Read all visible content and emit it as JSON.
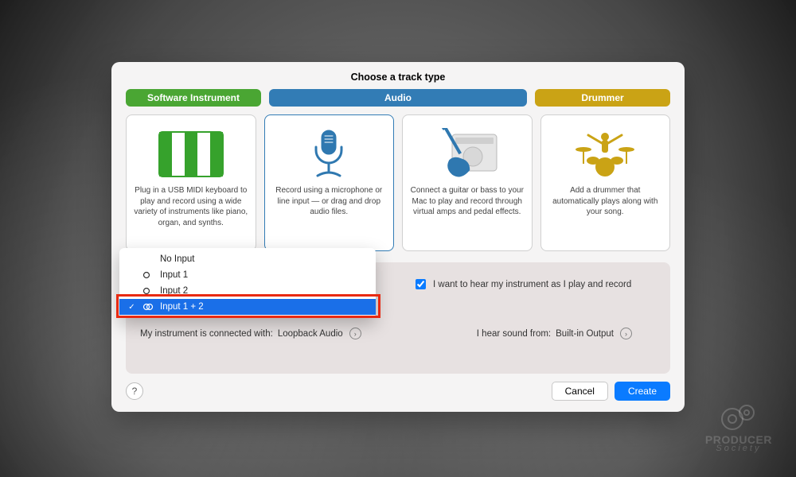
{
  "title": "Choose a track type",
  "tabs": {
    "software": "Software Instrument",
    "audio": "Audio",
    "drummer": "Drummer"
  },
  "cards": {
    "software": "Plug in a USB MIDI keyboard to play and record using a wide variety of instruments like piano, organ, and synths.",
    "mic": "Record using a microphone or line input — or drag and drop audio files.",
    "guitar": "Connect a guitar or bass to your Mac to play and record through virtual amps and pedal effects.",
    "drummer": "Add a drummer that automatically plays along with your song."
  },
  "dropdown": {
    "no_input": "No Input",
    "input1": "Input 1",
    "input2": "Input 2",
    "input12": "Input 1 + 2"
  },
  "details": {
    "hear_label": "I want to hear my instrument as I play and record",
    "connected_label": "My instrument is connected with:",
    "connected_value": "Loopback Audio",
    "output_label": "I hear sound from:",
    "output_value": "Built-in Output"
  },
  "footer": {
    "help": "?",
    "cancel": "Cancel",
    "create": "Create"
  },
  "watermark": {
    "name": "PRODUCER",
    "sub": "Society"
  }
}
